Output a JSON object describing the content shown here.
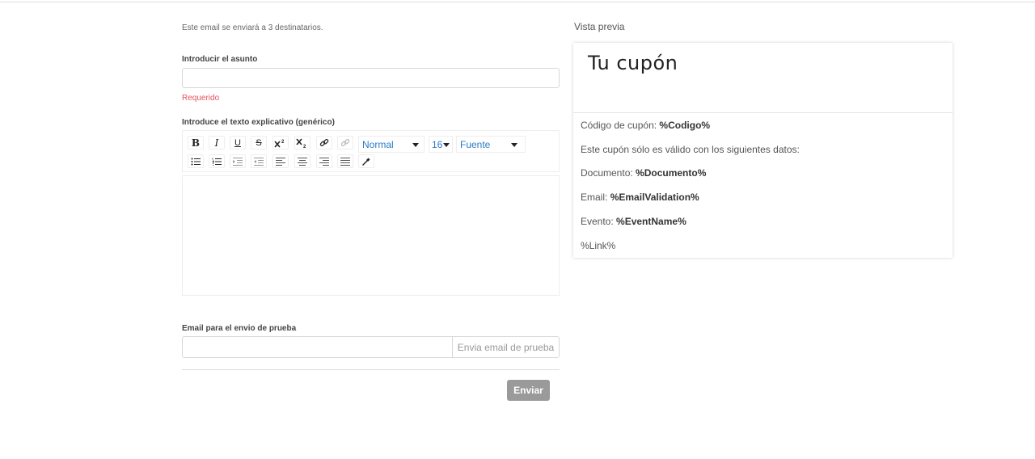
{
  "form": {
    "recipients_text": "Este email se enviará a 3 destinatarios.",
    "subject_label": "Introducir el asunto",
    "subject_value": "",
    "required_text": "Requerido",
    "body_label": "Introduce el texto explicativo (genérico)",
    "toolbar": {
      "bold": "B",
      "italic": "I",
      "underline": "U",
      "strike": "S",
      "format_select": "Normal",
      "size_select": "16",
      "font_select": "Fuente"
    },
    "test_email_label": "Email para el envio de prueba",
    "test_email_value": "",
    "test_email_button": "Envia email de prueba",
    "send_button": "Enviar"
  },
  "preview": {
    "label": "Vista previa",
    "title": "Tu cupón",
    "lines": [
      {
        "text": "Código de cupón: ",
        "bold": "%Codigo%"
      },
      {
        "text": "Este cupón sólo es válido con los siguientes datos:",
        "bold": ""
      },
      {
        "text": "Documento: ",
        "bold": "%Documento%"
      },
      {
        "text": "Email: ",
        "bold": "%EmailValidation%"
      },
      {
        "text": "Evento: ",
        "bold": "%EventName%"
      },
      {
        "text": "%Link%",
        "bold": ""
      }
    ]
  },
  "colors": {
    "required": "#e2535b",
    "select_text": "#2b7bc4",
    "send_button_bg": "#9a9a9a"
  }
}
